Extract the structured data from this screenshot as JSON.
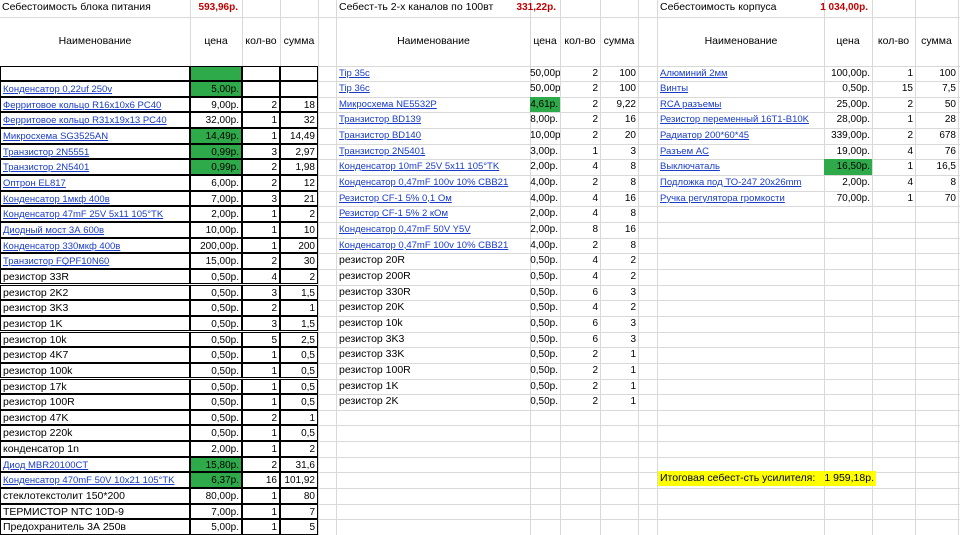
{
  "colors": {
    "green": "#2eaa4a",
    "link": "#1a3cc8",
    "total": "#c00000",
    "highlight": "#ffff00"
  },
  "t1": {
    "title": "Себестоимость блока питания",
    "total": "593,96р.",
    "headers": [
      "Наименование",
      "цена",
      "кол-во",
      "сумма"
    ],
    "rows": [
      [
        "",
        "",
        "",
        "",
        0,
        1
      ],
      [
        "Конденсатор 0,22uf 250v",
        "5,00р.",
        "",
        "",
        1,
        1
      ],
      [
        "Ферритовое кольцо R16х10х6 PC40",
        "9,00р.",
        "2",
        "18",
        1,
        0
      ],
      [
        "Ферритовое кольцо R31х19х13 PC40",
        "32,00р.",
        "1",
        "32",
        1,
        0
      ],
      [
        "Микросхема SG3525AN",
        "14,49р.",
        "1",
        "14,49",
        1,
        1
      ],
      [
        "Транзистор 2N5551",
        "0,99р.",
        "3",
        "2,97",
        1,
        1
      ],
      [
        "Транзистор 2N5401",
        "0,99р.",
        "2",
        "1,98",
        1,
        1
      ],
      [
        "Оптрон EL817",
        "6,00р.",
        "2",
        "12",
        1,
        0
      ],
      [
        "Конденсатор 1мкф 400в",
        "7,00р.",
        "3",
        "21",
        1,
        0
      ],
      [
        "Конденсатор 47mF 25V 5x11 105°TK",
        "2,00р.",
        "1",
        "2",
        1,
        0
      ],
      [
        "Диодный мост 3А 600в",
        "10,00р.",
        "1",
        "10",
        1,
        0
      ],
      [
        "Конденсатор 330мкф 400в",
        "200,00р.",
        "1",
        "200",
        1,
        0
      ],
      [
        "Транзистор FQPF10N60",
        "15,00р.",
        "2",
        "30",
        1,
        0
      ],
      [
        "резистор 33R",
        "0,50р.",
        "4",
        "2",
        0,
        0
      ],
      [
        "резистор 2K2",
        "0,50р.",
        "3",
        "1,5",
        0,
        0
      ],
      [
        "резистор 3K3",
        "0,50р.",
        "2",
        "1",
        0,
        0
      ],
      [
        "резистор 1K",
        "0,50р.",
        "3",
        "1,5",
        0,
        0
      ],
      [
        "резистор 10k",
        "0,50р.",
        "5",
        "2,5",
        0,
        0
      ],
      [
        "резистор 4K7",
        "0,50р.",
        "1",
        "0,5",
        0,
        0
      ],
      [
        "резистор 100k",
        "0,50р.",
        "1",
        "0,5",
        0,
        0
      ],
      [
        "резистор 17k",
        "0,50р.",
        "1",
        "0,5",
        0,
        0
      ],
      [
        "резистор 100R",
        "0,50р.",
        "1",
        "0,5",
        0,
        0
      ],
      [
        "резистор 47K",
        "0,50р.",
        "2",
        "1",
        0,
        0
      ],
      [
        "резистор 220k",
        "0,50р.",
        "1",
        "0,5",
        0,
        0
      ],
      [
        "конденсатор 1n",
        "2,00р.",
        "1",
        "2",
        0,
        0
      ],
      [
        "Диод MBR20100CT",
        "15,80р.",
        "2",
        "31,6",
        1,
        1
      ],
      [
        "Конденсатор 470mF 50V 10x21 105°TK",
        "6,37р.",
        "16",
        "101,92",
        1,
        1
      ],
      [
        "стеклотекстолит 150*200",
        "80,00р.",
        "1",
        "80",
        0,
        0
      ],
      [
        "ТЕРМИСТОР NTC 10D-9",
        "7,00р.",
        "1",
        "7",
        0,
        0
      ],
      [
        "Предохранитель 3А 250в",
        "5,00р.",
        "1",
        "5",
        0,
        0
      ]
    ]
  },
  "t2": {
    "title": "Себест-ть 2-х каналов по 100вт",
    "total": "331,22р.",
    "headers": [
      "Наименование",
      "цена",
      "кол-во",
      "сумма"
    ],
    "rows": [
      [
        "Tip 35c",
        "50,00р.",
        "2",
        "100",
        1,
        0
      ],
      [
        "Tip 36c",
        "50,00р.",
        "2",
        "100",
        1,
        0
      ],
      [
        "Микросхема NE5532P",
        "4,61р.",
        "2",
        "9,22",
        1,
        1
      ],
      [
        "Транзистор BD139",
        "8,00р.",
        "2",
        "16",
        1,
        0
      ],
      [
        "Транзистор BD140",
        "10,00р.",
        "2",
        "20",
        1,
        0
      ],
      [
        "Транзистор 2N5401",
        "3,00р.",
        "1",
        "3",
        1,
        0
      ],
      [
        "Конденсатор 10mF 25V 5x11 105°TK",
        "2,00р.",
        "4",
        "8",
        1,
        0
      ],
      [
        "Конденсатор 0,47mF 100v 10% CBB21",
        "4,00р.",
        "2",
        "8",
        1,
        0
      ],
      [
        "Резистор CF-1 5% 0,1 Ом",
        "4,00р.",
        "4",
        "16",
        1,
        0
      ],
      [
        "Резистор CF-1 5% 2 кОм",
        "2,00р.",
        "4",
        "8",
        1,
        0
      ],
      [
        "Конденсатор 0,47mF 50V Y5V",
        "2,00р.",
        "8",
        "16",
        1,
        0
      ],
      [
        "Конденсатор 0,47mF 100v 10% CBB21",
        "4,00р.",
        "2",
        "8",
        1,
        0
      ],
      [
        "резистор 20R",
        "0,50р.",
        "4",
        "2",
        0,
        0
      ],
      [
        "резистор 200R",
        "0,50р.",
        "4",
        "2",
        0,
        0
      ],
      [
        "резистор 330R",
        "0,50р.",
        "6",
        "3",
        0,
        0
      ],
      [
        "резистор 20K",
        "0,50р.",
        "4",
        "2",
        0,
        0
      ],
      [
        "резистор 10k",
        "0,50р.",
        "6",
        "3",
        0,
        0
      ],
      [
        "резистор 3K3",
        "0,50р.",
        "6",
        "3",
        0,
        0
      ],
      [
        "резистор 33K",
        "0,50р.",
        "2",
        "1",
        0,
        0
      ],
      [
        "резистор 100R",
        "0,50р.",
        "2",
        "1",
        0,
        0
      ],
      [
        "резистор 1K",
        "0,50р.",
        "2",
        "1",
        0,
        0
      ],
      [
        "резистор 2K",
        "0,50р.",
        "2",
        "1",
        0,
        0
      ]
    ]
  },
  "t3": {
    "title": "Себестоимость корпуса",
    "total": "1 034,00р.",
    "headers": [
      "Наименование",
      "цена",
      "кол-во",
      "сумма"
    ],
    "rows": [
      [
        "Алюминий 2мм",
        "100,00р.",
        "1",
        "100",
        1,
        0
      ],
      [
        "Винты",
        "0,50р.",
        "15",
        "7,5",
        1,
        0
      ],
      [
        "RCA разъемы",
        "25,00р.",
        "2",
        "50",
        1,
        0
      ],
      [
        "Резистор переменный 16T1-B10K",
        "28,00р.",
        "1",
        "28",
        1,
        0
      ],
      [
        "Радиатор 200*60*45",
        "339,00р.",
        "2",
        "678",
        1,
        0
      ],
      [
        "Разъем AC",
        "19,00р.",
        "4",
        "76",
        1,
        0
      ],
      [
        "Выключаталь",
        "16,50р.",
        "1",
        "16,5",
        1,
        1
      ],
      [
        "Подложка под ТО-247 20x26mm",
        "2,00р.",
        "4",
        "8",
        1,
        0
      ],
      [
        "Ручка регулятора громкости",
        "70,00р.",
        "1",
        "70",
        1,
        0
      ]
    ]
  },
  "grand": {
    "label": "Итоговая себест-сть усилителя:",
    "value": "1 959,18р."
  }
}
